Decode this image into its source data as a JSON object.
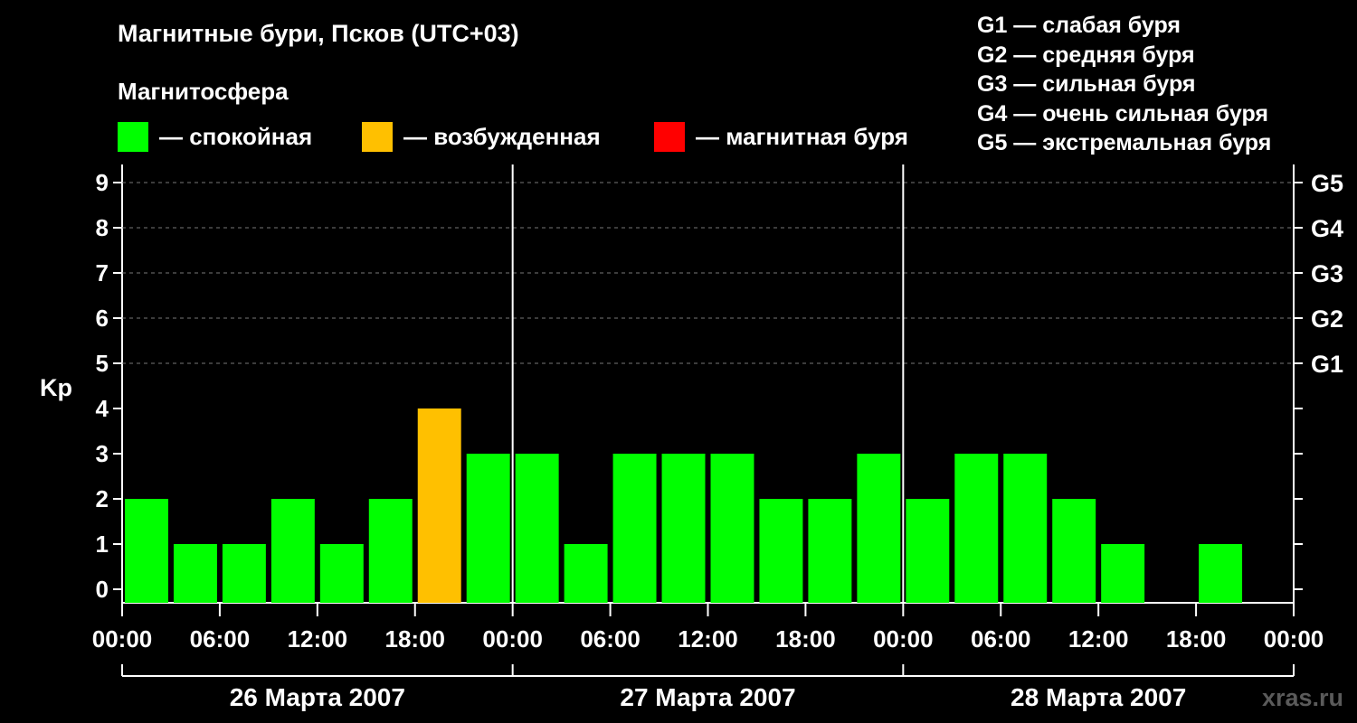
{
  "header": {
    "title": "Магнитные бури, Псков (UTC+03)",
    "subtitle": "Магнитосфера"
  },
  "legend": [
    {
      "label": "— спокойная",
      "color": "#00ff00"
    },
    {
      "label": "— возбужденная",
      "color": "#ffc000"
    },
    {
      "label": "— магнитная буря",
      "color": "#ff0000"
    }
  ],
  "g_scale": [
    "G1 — слабая буря",
    "G2 — средняя буря",
    "G3 — сильная буря",
    "G4 — очень сильная буря",
    "G5 — экстремальная буря"
  ],
  "watermark": "xras.ru",
  "chart_data": {
    "type": "bar",
    "ylabel": "Kp",
    "ylim": [
      0,
      9
    ],
    "y_ticks": [
      "0",
      "1",
      "2",
      "3",
      "4",
      "5",
      "6",
      "7",
      "8",
      "9"
    ],
    "right_axis_labels": [
      {
        "y": 5,
        "label": "G1"
      },
      {
        "y": 6,
        "label": "G2"
      },
      {
        "y": 7,
        "label": "G3"
      },
      {
        "y": 8,
        "label": "G4"
      },
      {
        "y": 9,
        "label": "G5"
      }
    ],
    "x_tick_labels": [
      "00:00",
      "06:00",
      "12:00",
      "18:00",
      "00:00",
      "06:00",
      "12:00",
      "18:00",
      "00:00",
      "06:00",
      "12:00",
      "18:00",
      "00:00"
    ],
    "days": [
      "26 Марта 2007",
      "27 Марта 2007",
      "28 Марта 2007"
    ],
    "interval_hours": 3,
    "values": [
      2,
      1,
      1,
      2,
      1,
      2,
      4,
      3,
      3,
      1,
      3,
      3,
      3,
      2,
      2,
      3,
      2,
      3,
      3,
      2,
      1,
      0,
      1,
      0
    ],
    "levels": [
      "quiet",
      "quiet",
      "quiet",
      "quiet",
      "quiet",
      "quiet",
      "active",
      "quiet",
      "quiet",
      "quiet",
      "quiet",
      "quiet",
      "quiet",
      "quiet",
      "quiet",
      "quiet",
      "quiet",
      "quiet",
      "quiet",
      "quiet",
      "quiet",
      "quiet",
      "quiet",
      "quiet"
    ],
    "colors": {
      "quiet": "#00ff00",
      "active": "#ffc000",
      "storm": "#ff0000"
    },
    "grid": "dashed at 5-9"
  }
}
